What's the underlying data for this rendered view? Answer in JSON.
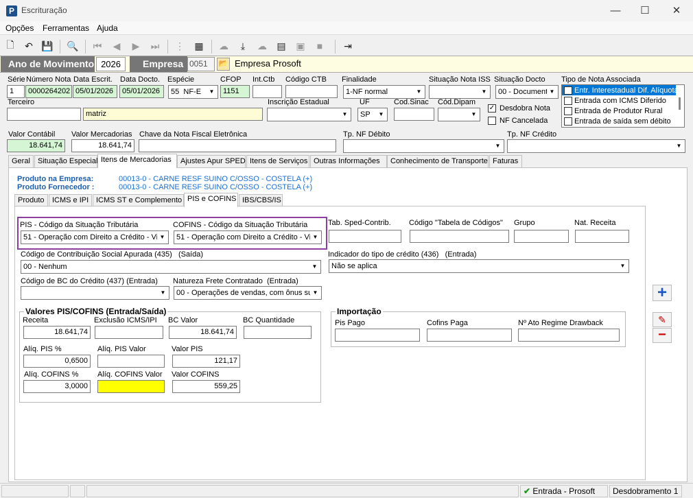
{
  "window": {
    "title": "Escrituração",
    "minimize": "—",
    "maximize": "☐",
    "close": "✕"
  },
  "menu": [
    "Opções",
    "Ferramentas",
    "Ajuda"
  ],
  "year_bar": {
    "ano_label": "Ano de Movimento",
    "ano_value": "2026",
    "empresa_label": "Empresa",
    "empresa_code": "0051",
    "empresa_name": "Empresa Prosoft"
  },
  "header": {
    "serie_label": "Série",
    "serie": "1",
    "numero_label": "Número Nota",
    "numero": "0000264202",
    "data_escrit_label": "Data Escrit.",
    "data_escrit": "05/01/2026",
    "data_docto_label": "Data Docto.",
    "data_docto": "05/01/2026",
    "especie_label": "Espécie",
    "especie_code": "55",
    "especie": "NF-E",
    "cfop_label": "CFOP",
    "cfop": "1151",
    "intctb_label": "Int.Ctb",
    "intctb": "",
    "codigo_ctb_label": "Código CTB",
    "codigo_ctb": "",
    "finalidade_label": "Finalidade",
    "finalidade": "1-NF normal",
    "situacao_iss_label": "Situação Nota ISS",
    "situacao_iss": "",
    "situacao_docto_label": "Situação Docto",
    "situacao_docto": "00 - Document",
    "tipo_nota_label": "Tipo de Nota Associada",
    "tipo_nota_items": [
      "Entr. Interestadual Dif. Alíquota",
      "Entrada com ICMS Diferido",
      "Entrada de Produtor Rural",
      "Entrada de saída sem débito"
    ],
    "terceiro_label": "Terceiro",
    "terceiro_code": "",
    "terceiro_name": "matriz",
    "inscricao_label": "Inscrição Estadual",
    "inscricao": "",
    "uf_label": "UF",
    "uf": "SP",
    "cod_sinac_label": "Cod.Sinac",
    "cod_sinac": "",
    "cod_dipam_label": "Cód.Dipam",
    "cod_dipam": "",
    "desdobra_label": "Desdobra Nota",
    "nf_cancelada_label": "NF Cancelada",
    "valor_contabil_label": "Valor Contábil",
    "valor_contabil": "18.641,74",
    "valor_merc_label": "Valor Mercadorias",
    "valor_merc": "18.641,74",
    "chave_label": "Chave da Nota Fiscal Eletrônica",
    "chave": "",
    "tp_nf_debito_label": "Tp. NF Débito",
    "tp_nf_debito": "",
    "tp_nf_credito_label": "Tp. NF Crédito",
    "tp_nf_credito": ""
  },
  "main_tabs": [
    "Geral",
    "Situação Especial",
    "Itens de Mercadorias",
    "Ajustes Apur SPED",
    "Itens de Serviços",
    "Outras Informações",
    "Conhecimento de Transporte",
    "Faturas"
  ],
  "product": {
    "empresa_label": "Produto na Empresa:",
    "empresa_value": "00013-0 - CARNE RESF SUINO C/OSSO - COSTELA (+)",
    "fornecedor_label": "Produto Fornecedor :",
    "fornecedor_value": "00013-0 - CARNE RESF SUINO C/OSSO - COSTELA (+)"
  },
  "sub_tabs": [
    "Produto",
    "ICMS e IPI",
    "ICMS ST e Complemento",
    "PIS e COFINS",
    "IBS/CBS/IS"
  ],
  "pis_cofins": {
    "pis_cst_label": "PIS - Código da Situação Tributária",
    "pis_cst": "51 - Operação com Direito a Crédito - Vin",
    "cofins_cst_label": "COFINS - Código da Situação Tributária",
    "cofins_cst": "51 - Operação com Direito a Crédito - Vin",
    "tab_sped_label": "Tab. Sped-Contrib.",
    "tab_codigos_label": "Código \"Tabela de Códigos\"",
    "grupo_label": "Grupo",
    "nat_receita_label": "Nat. Receita",
    "ccs_label": "Código de Contribuição Social Apurada (435)",
    "ccs_sub": "(Saída)",
    "ccs": "00 - Nenhum",
    "ind_credito_label": "Indicador do tipo de crédito (436)",
    "ind_credito_sub": "(Entrada)",
    "ind_credito": "Não se aplica",
    "bc_credito_label": "Código de BC do Crédito (437) (Entrada)",
    "bc_credito": "",
    "natureza_frete_label": "Natureza Frete Contratado",
    "natureza_frete_sub": "(Entrada)",
    "natureza_frete": "00 - Operações de vendas, com ônus su"
  },
  "valores": {
    "title": "Valores PIS/COFINS (Entrada/Saída)",
    "receita_label": "Receita",
    "receita": "18.641,74",
    "exclusao_label": "Exclusão ICMS/IPI",
    "exclusao": "",
    "bc_valor_label": "BC Valor",
    "bc_valor": "18.641,74",
    "bc_qtd_label": "BC Quantidade",
    "bc_qtd": "",
    "aliq_pis_label": "Alíq. PIS %",
    "aliq_pis": "0,6500",
    "aliq_pis_valor_label": "Alíq. PIS Valor",
    "aliq_pis_valor": "",
    "valor_pis_label": "Valor PIS",
    "valor_pis": "121,17",
    "aliq_cofins_label": "Alíq. COFINS %",
    "aliq_cofins": "3,0000",
    "aliq_cofins_valor_label": "Alíq. COFINS Valor",
    "aliq_cofins_valor": "",
    "valor_cofins_label": "Valor COFINS",
    "valor_cofins": "559,25"
  },
  "importacao": {
    "title": "Importação",
    "pis_pago_label": "Pis Pago",
    "cofins_paga_label": "Cofins Paga",
    "drawback_label": "Nº Ato Regime Drawback"
  },
  "status": {
    "mode": "Entrada - Prosoft",
    "desdobramento": "Desdobramento 1"
  },
  "colors": {
    "highlight_border": "#8b3fa0",
    "accent": "#1a5fb4",
    "selection": "#0078d7"
  }
}
